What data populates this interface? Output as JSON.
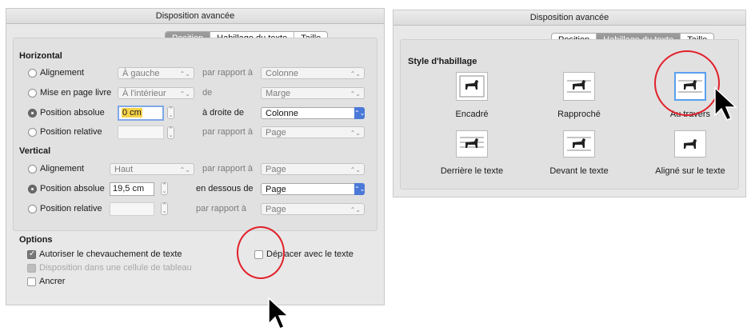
{
  "left_dialog": {
    "title": "Disposition avancée",
    "tabs": [
      "Position",
      "Habillage du texte",
      "Taille"
    ],
    "active_tab": "Position",
    "horizontal": {
      "heading": "Horizontal",
      "rows": [
        {
          "label": "Alignement",
          "value": "À gauche",
          "relation": "par rapport à",
          "target": "Colonne"
        },
        {
          "label": "Mise en page livre",
          "value": "À l'intérieur",
          "relation": "de",
          "target": "Marge"
        },
        {
          "label": "Position absolue",
          "value": "0 cm",
          "relation": "à droite de",
          "target": "Colonne"
        },
        {
          "label": "Position relative",
          "value": "",
          "relation": "par rapport à",
          "target": "Page"
        }
      ]
    },
    "vertical": {
      "heading": "Vertical",
      "rows": [
        {
          "label": "Alignement",
          "value": "Haut",
          "relation": "par rapport à",
          "target": "Page"
        },
        {
          "label": "Position absolue",
          "value": "19,5 cm",
          "relation": "en dessous de",
          "target": "Page"
        },
        {
          "label": "Position relative",
          "value": "",
          "relation": "par rapport à",
          "target": "Page"
        }
      ]
    },
    "options": {
      "heading": "Options",
      "allow_overlap": "Autoriser le chevauchement de texte",
      "table_cell": "Disposition dans une cellule de tableau",
      "anchor": "Ancrer",
      "move_with_text": "Déplacer avec le texte"
    }
  },
  "right_dialog": {
    "title": "Disposition avancée",
    "tabs": [
      "Position",
      "Habillage du texte",
      "Taille"
    ],
    "active_tab": "Habillage du texte",
    "heading": "Style d'habillage",
    "styles": [
      "Encadré",
      "Rapproché",
      "Au travers",
      "Derrière le texte",
      "Devant le texte",
      "Aligné sur le texte"
    ],
    "selected_style": "Au travers"
  },
  "colors": {
    "highlight_circle": "#e2202a",
    "focus_ring": "#7fa8e8",
    "selected_border": "#5aa0ef"
  }
}
